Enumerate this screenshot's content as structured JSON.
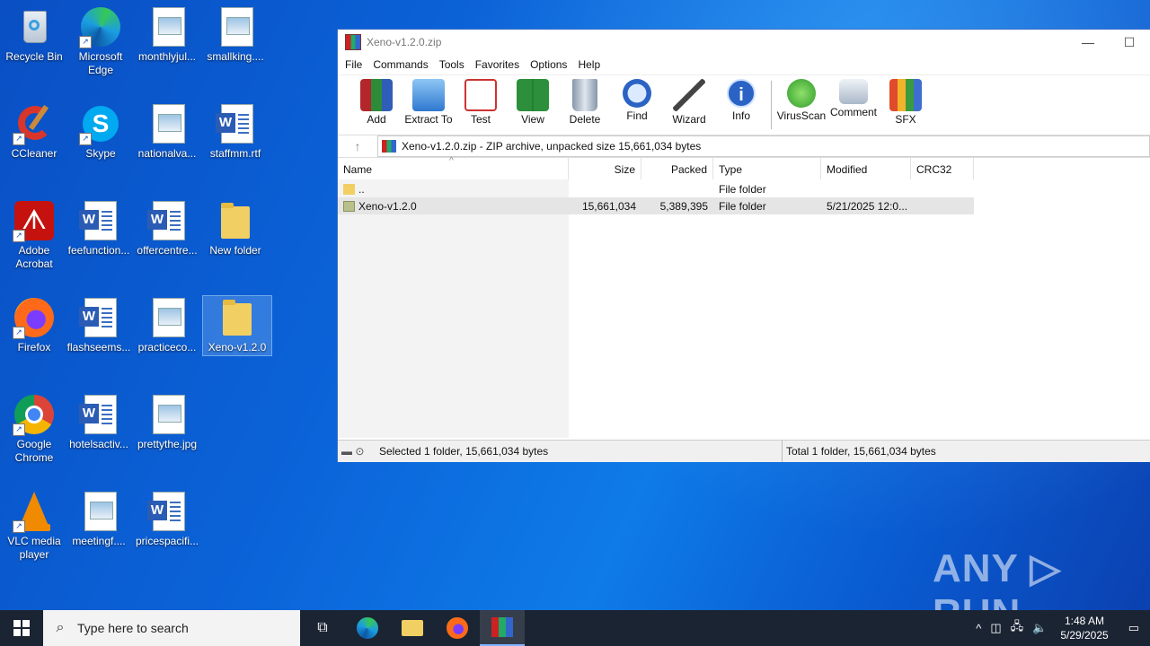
{
  "desktop": {
    "icons": [
      {
        "label": "Recycle Bin"
      },
      {
        "label": "Microsoft Edge"
      },
      {
        "label": "monthlyjul..."
      },
      {
        "label": "smallking...."
      },
      {
        "label": "CCleaner"
      },
      {
        "label": "Skype"
      },
      {
        "label": "nationalva..."
      },
      {
        "label": "staffmm.rtf"
      },
      {
        "label": "Adobe Acrobat"
      },
      {
        "label": "feefunction..."
      },
      {
        "label": "offercentre..."
      },
      {
        "label": "New folder"
      },
      {
        "label": "Firefox"
      },
      {
        "label": "flashseems..."
      },
      {
        "label": "practiceco..."
      },
      {
        "label": "Xeno-v1.2.0"
      },
      {
        "label": "Google Chrome"
      },
      {
        "label": "hotelsactiv..."
      },
      {
        "label": "prettythe.jpg"
      },
      {
        "label": "VLC media player"
      },
      {
        "label": "meetingf...."
      },
      {
        "label": "pricespacifi..."
      }
    ]
  },
  "window": {
    "title": "Xeno-v1.2.0.zip",
    "controls": {
      "minimize": "—",
      "maximize": "☐"
    },
    "menu": [
      "File",
      "Commands",
      "Tools",
      "Favorites",
      "Options",
      "Help"
    ],
    "toolbar": [
      "Add",
      "Extract To",
      "Test",
      "View",
      "Delete",
      "Find",
      "Wizard",
      "Info",
      "VirusScan",
      "Comment",
      "SFX"
    ],
    "address": "Xeno-v1.2.0.zip - ZIP archive, unpacked size 15,661,034 bytes",
    "columns": [
      "Name",
      "Size",
      "Packed",
      "Type",
      "Modified",
      "CRC32"
    ],
    "rows": [
      {
        "name": "..",
        "size": "",
        "packed": "",
        "type": "File folder",
        "modified": "",
        "crc": ""
      },
      {
        "name": "Xeno-v1.2.0",
        "size": "15,661,034",
        "packed": "5,389,395",
        "type": "File folder",
        "modified": "5/21/2025 12:0...",
        "crc": ""
      }
    ],
    "status_left": "Selected 1 folder, 15,661,034 bytes",
    "status_right": "Total 1 folder, 15,661,034 bytes"
  },
  "watermark": "ANY ▷ RUN",
  "taskbar": {
    "search_placeholder": "Type here to search",
    "time": "1:48 AM",
    "date": "5/29/2025"
  },
  "colors": {
    "taskbar": "#1b2433",
    "desktop": "#0b63d8",
    "selection": "#e5e5e5"
  }
}
